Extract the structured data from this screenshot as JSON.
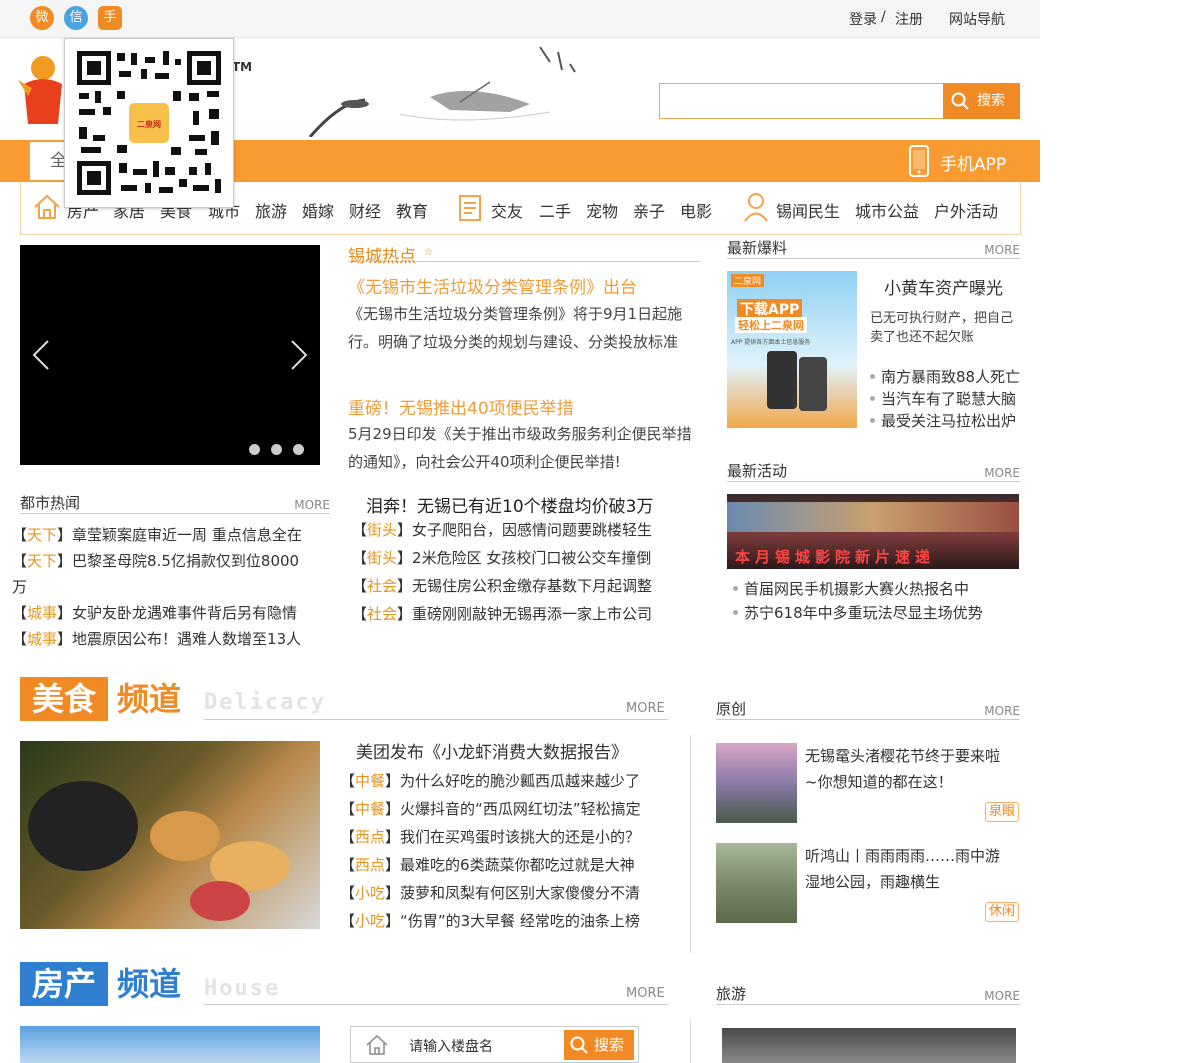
{
  "topbar": {
    "social_weibo": "微",
    "social_wechat": "信",
    "social_mobile": "手",
    "login": "登录",
    "separator": "/",
    "register": "注册",
    "site_nav": "网站导航"
  },
  "header": {
    "tm": "TM",
    "search_placeholder": "",
    "search_button": "搜索",
    "mobile_app": "手机APP",
    "city_select": "全",
    "qr_center": "二泉网"
  },
  "nav": {
    "group1": [
      "房产",
      "家居",
      "美食",
      "城市",
      "旅游",
      "婚嫁",
      "财经",
      "教育"
    ],
    "group2": [
      "交友",
      "二手",
      "宠物",
      "亲子",
      "电影"
    ],
    "group3": [
      "锡闻民生",
      "城市公益",
      "户外活动"
    ]
  },
  "hot": {
    "title": "锡城热点",
    "item1_title": "《无锡市生活垃圾分类管理条例》出台",
    "item1_desc": "《无锡市生活垃圾分类管理条例》将于9月1日起施行。明确了垃圾分类的规划与建设、分类投放标准",
    "item2_title": "重磅！无锡推出40项便民举措",
    "item2_desc": "5月29日印发《关于推出市级政务服务利企便民举措的通知》，向社会公开40项利企便民举措!",
    "headline": "泪奔！无锡已有近10个楼盘均价破3万",
    "list": [
      {
        "tag": "街头",
        "text": "女子爬阳台，因感情问题要跳楼轻生"
      },
      {
        "tag": "街头",
        "text": "2米危险区 女孩校门口被公交车撞倒"
      },
      {
        "tag": "社会",
        "text": "无锡住房公积金缴存基数下月起调整"
      },
      {
        "tag": "社会",
        "text": "重磅刚刚敲钟无锡再添一家上市公司"
      }
    ]
  },
  "city_hot": {
    "title": "都市热闻",
    "more": "MORE",
    "list": [
      {
        "tag": "天下",
        "text": "章莹颖案庭审近一周 重点信息全在"
      },
      {
        "tag": "天下",
        "text": "巴黎圣母院8.5亿捐款仅到位8000",
        "text2": "万"
      },
      {
        "tag": "城事",
        "text": "女驴友卧龙遇难事件背后另有隐情"
      },
      {
        "tag": "城事",
        "text": "地震原因公布！遇难人数增至13人"
      }
    ]
  },
  "breaking": {
    "title": "最新爆料",
    "more": "MORE",
    "ad_top": "二泉网",
    "ad_line1": "下载APP",
    "ad_line2": "轻松上二泉网",
    "ad_small": "APP 提供各方面本土信息服务",
    "feature_title": "小黄车资产曝光",
    "feature_desc": "已无可执行财产，把自己卖了也还不起欠账",
    "list": [
      "南方暴雨致88人死亡",
      "当汽车有了聪慧大脑",
      "最受关注马拉松出炉"
    ]
  },
  "activity": {
    "title": "最新活动",
    "more": "MORE",
    "banner_text": "本月锡城影院新片速递",
    "list": [
      "首届网民手机摄影大赛火热报名中",
      "苏宁618年中多重玩法尽显主场优势"
    ]
  },
  "food": {
    "cn1": "美食",
    "cn2": "频道",
    "en": "Delicacy",
    "more": "MORE",
    "headline": "美团发布《小龙虾消费大数据报告》",
    "list": [
      {
        "tag": "中餐",
        "text": "为什么好吃的脆沙瓤西瓜越来越少了"
      },
      {
        "tag": "中餐",
        "text": "火爆抖音的“西瓜网红切法”轻松搞定"
      },
      {
        "tag": "西点",
        "text": "我们在买鸡蛋时该挑大的还是小的？"
      },
      {
        "tag": "西点",
        "text": "最难吃的6类蔬菜你都吃过就是大神"
      },
      {
        "tag": "小吃",
        "text": "菠萝和凤梨有何区别大家傻傻分不清"
      },
      {
        "tag": "小吃",
        "text": "“伤胃”的3大早餐 经常吃的油条上榜"
      }
    ]
  },
  "original": {
    "title": "原创",
    "more": "MORE",
    "items": [
      {
        "text1": "无锡鼋头渚樱花节终于要来啦",
        "text2": "~你想知道的都在这！",
        "badge": "泉眼"
      },
      {
        "text1": "听鸿山丨雨雨雨雨……雨中游",
        "text2": "湿地公园，雨趣横生",
        "badge": "休闲"
      }
    ]
  },
  "house": {
    "cn1": "房产",
    "cn2": "频道",
    "en": "House",
    "more": "MORE",
    "search_placeholder": "请输入楼盘名",
    "search_button": "搜索"
  },
  "travel": {
    "title": "旅游",
    "more": "MORE"
  },
  "colors": {
    "brand": "#fa9b31",
    "tag": "#e8941f",
    "house_blue": "#2f7fd0"
  }
}
